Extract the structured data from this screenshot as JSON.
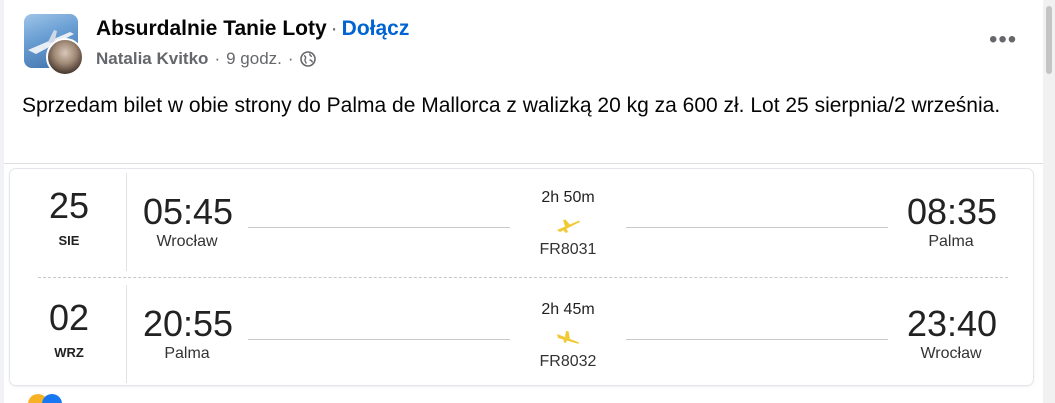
{
  "header": {
    "group_name": "Absurdalnie Tanie Loty",
    "separator": "·",
    "join_label": "Dołącz",
    "author": "Natalia Kvitko",
    "meta_separator": "·",
    "timestamp": "9 godz.",
    "privacy_icon": "globe-icon",
    "more_icon": "more-horizontal-icon",
    "more_glyph": "•••"
  },
  "post": {
    "text": "Sprzedam bilet w obie strony do Palma de Mallorca z walizką 20 kg za 600 zł. Lot 25 sierpnia/2 września."
  },
  "flights": [
    {
      "day": "25",
      "month": "SIE",
      "departure_time": "05:45",
      "departure_city": "Wrocław",
      "duration": "2h 50m",
      "flight_number": "FR8031",
      "arrival_time": "08:35",
      "arrival_city": "Palma",
      "plane_icon": "plane-takeoff-icon"
    },
    {
      "day": "02",
      "month": "WRZ",
      "departure_time": "20:55",
      "departure_city": "Palma",
      "duration": "2h 45m",
      "flight_number": "FR8032",
      "arrival_time": "23:40",
      "arrival_city": "Wrocław",
      "plane_icon": "plane-landing-icon"
    }
  ],
  "colors": {
    "accent_link": "#0064d1",
    "plane": "#f1c933",
    "text_primary": "#050505",
    "text_secondary": "#65676b"
  }
}
